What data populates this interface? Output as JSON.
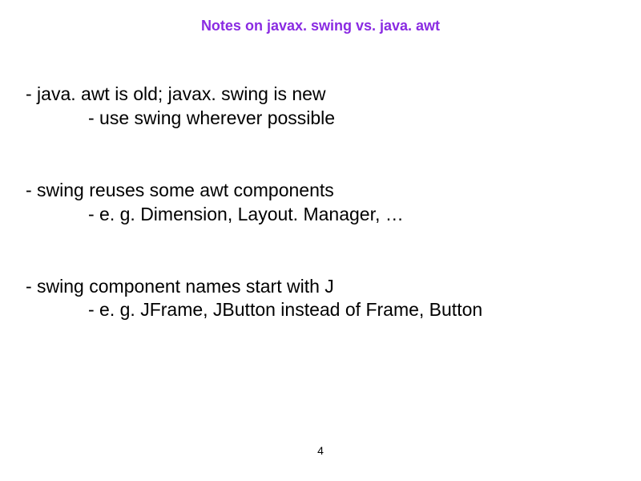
{
  "title": "Notes on javax. swing vs. java. awt",
  "bullets": [
    {
      "main": "- java. awt is old; javax. swing is new",
      "sub": "- use swing wherever possible"
    },
    {
      "main": "- swing reuses some awt components",
      "sub": "- e. g. Dimension, Layout. Manager, …"
    },
    {
      "main": "- swing component names start with J",
      "sub": "- e. g. JFrame, JButton instead of Frame, Button"
    }
  ],
  "page_number": "4"
}
